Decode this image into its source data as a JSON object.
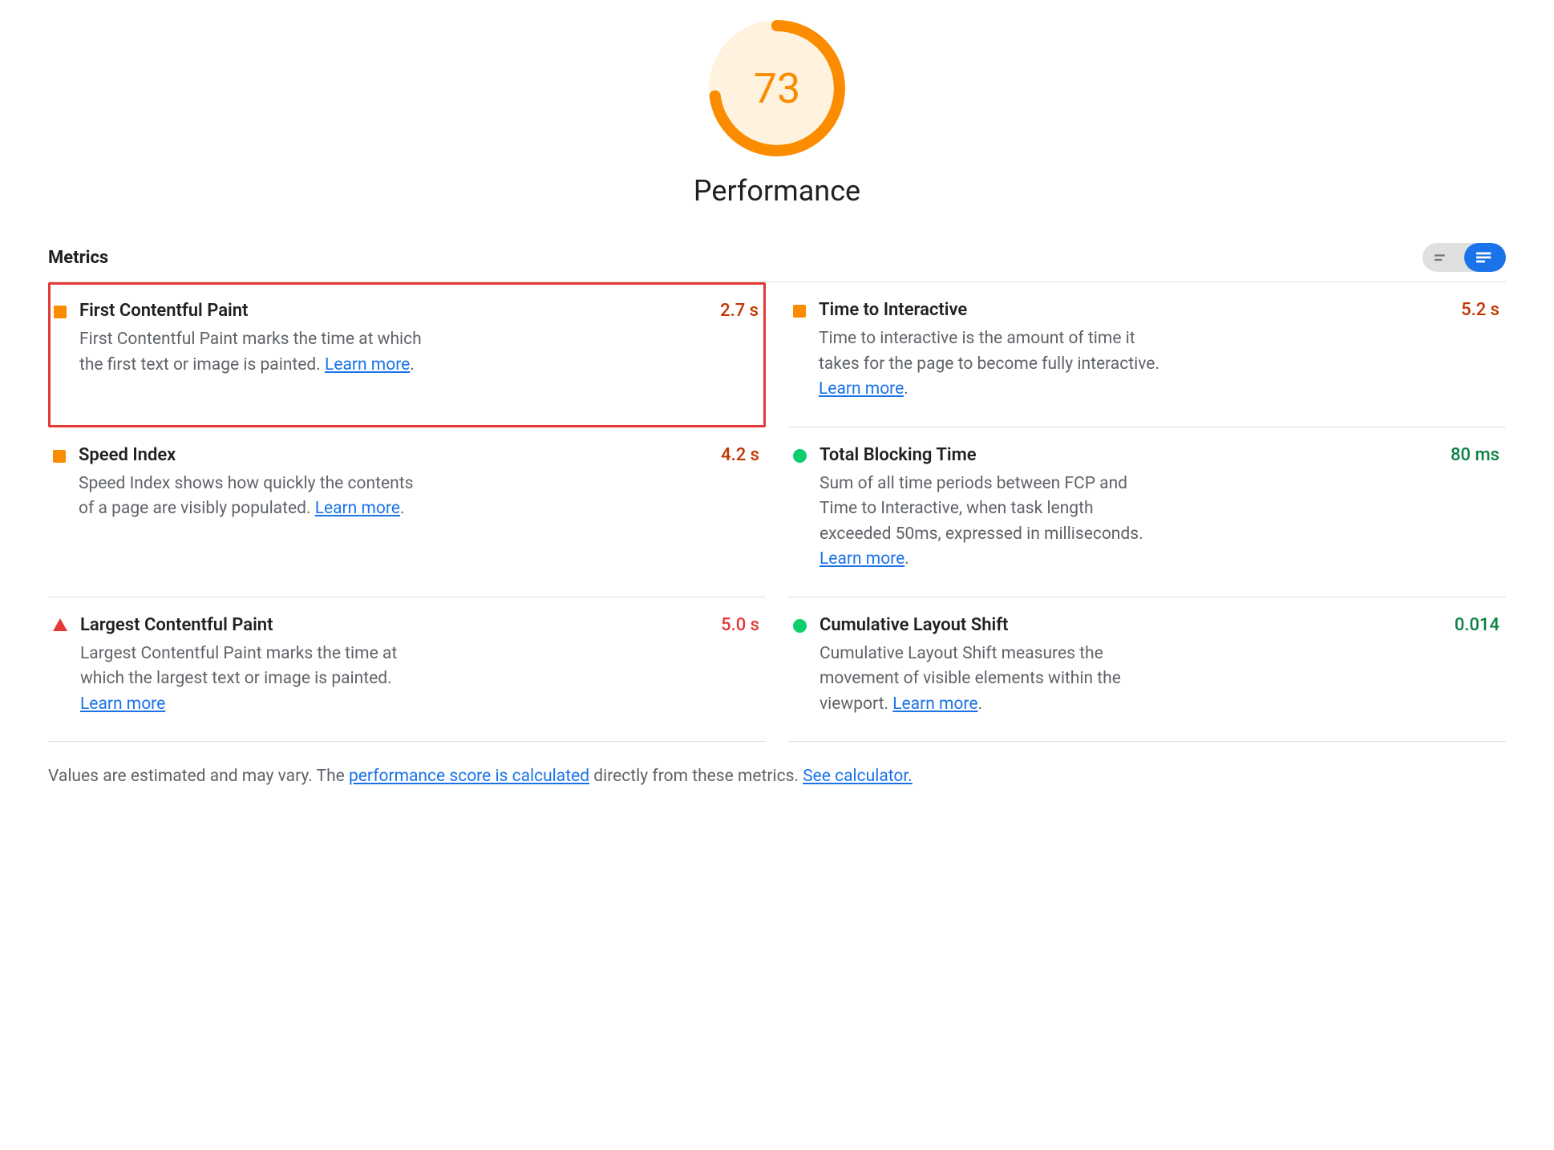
{
  "score": {
    "value": "73",
    "percent": 73,
    "title": "Performance"
  },
  "metricsHeader": "Metrics",
  "metrics": [
    {
      "id": "fcp",
      "name": "First Contentful Paint",
      "value": "2.7 s",
      "status": "average",
      "valColor": "orange",
      "highlight": true,
      "desc": "First Contentful Paint marks the time at which the first text or image is painted. ",
      "learn": "Learn more",
      "trailingDot": "."
    },
    {
      "id": "tti",
      "name": "Time to Interactive",
      "value": "5.2 s",
      "status": "average",
      "valColor": "orange",
      "highlight": false,
      "desc": "Time to interactive is the amount of time it takes for the page to become fully interactive. ",
      "learn": "Learn more",
      "trailingDot": "."
    },
    {
      "id": "si",
      "name": "Speed Index",
      "value": "4.2 s",
      "status": "average",
      "valColor": "orange",
      "highlight": false,
      "desc": "Speed Index shows how quickly the contents of a page are visibly populated. ",
      "learn": "Learn more",
      "trailingDot": "."
    },
    {
      "id": "tbt",
      "name": "Total Blocking Time",
      "value": "80 ms",
      "status": "good",
      "valColor": "green",
      "highlight": false,
      "desc": "Sum of all time periods between FCP and Time to Interactive, when task length exceeded 50ms, expressed in milliseconds. ",
      "learn": "Learn more",
      "trailingDot": "."
    },
    {
      "id": "lcp",
      "name": "Largest Contentful Paint",
      "value": "5.0 s",
      "status": "poor",
      "valColor": "red",
      "highlight": false,
      "desc": "Largest Contentful Paint marks the time at which the largest text or image is painted. ",
      "learn": "Learn more",
      "trailingDot": ""
    },
    {
      "id": "cls",
      "name": "Cumulative Layout Shift",
      "value": "0.014",
      "status": "good",
      "valColor": "green",
      "highlight": false,
      "desc": "Cumulative Layout Shift measures the movement of visible elements within the viewport. ",
      "learn": "Learn more",
      "trailingDot": "."
    }
  ],
  "footnote": {
    "pre": "Values are estimated and may vary. The ",
    "link1": "performance score is calculated",
    "mid": " directly from these metrics. ",
    "link2": "See calculator."
  }
}
